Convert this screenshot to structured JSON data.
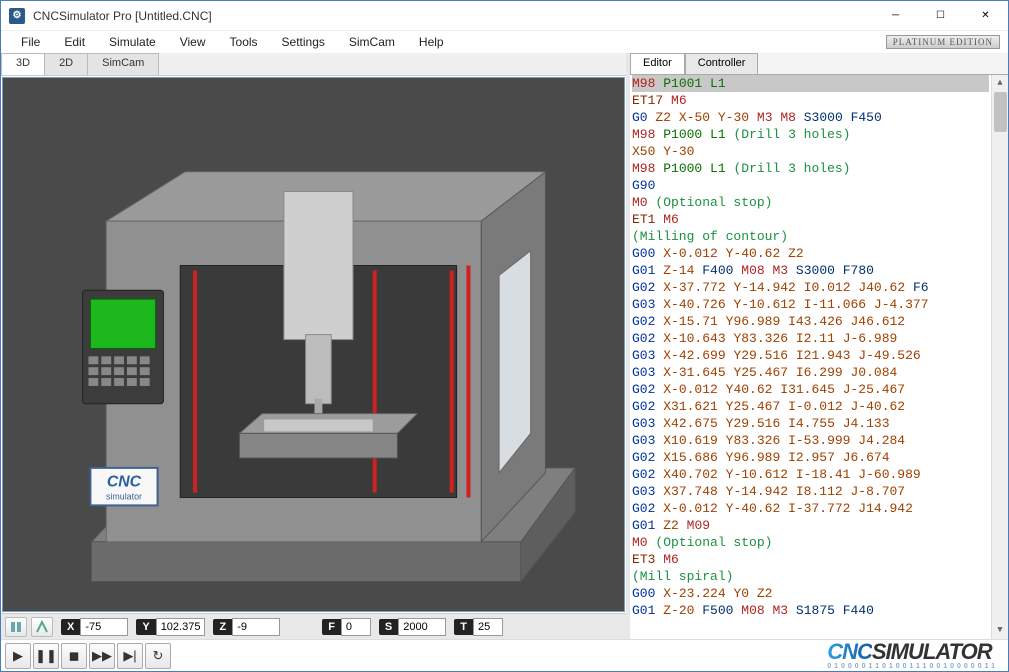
{
  "window": {
    "title": "CNCSimulator Pro [Untitled.CNC]",
    "edition": "PLATINUM EDITION"
  },
  "menu": {
    "items": [
      "File",
      "Edit",
      "Simulate",
      "View",
      "Tools",
      "Settings",
      "SimCam",
      "Help"
    ]
  },
  "view_tabs": {
    "items": [
      "3D",
      "2D",
      "SimCam"
    ],
    "active": "3D"
  },
  "axes": {
    "X": "-75",
    "Y": "102.375",
    "Z": "-9",
    "F": "0",
    "S": "2000",
    "T": "25"
  },
  "editor_tabs": {
    "items": [
      "Editor",
      "Controller"
    ],
    "active": "Editor"
  },
  "code_lines": [
    "M98 P1001 L1",
    "ET17 M6",
    "G0 Z2 X-50 Y-30 M3 M8 S3000 F450",
    "M98 P1000 L1 (Drill 3 holes)",
    "X50 Y-30",
    "M98 P1000 L1 (Drill 3 holes)",
    "G90",
    "M0 (Optional stop)",
    "ET1 M6",
    "(Milling of contour)",
    "G00 X-0.012 Y-40.62 Z2",
    "G01 Z-14 F400 M08 M3 S3000 F780",
    "G02 X-37.772 Y-14.942 I0.012 J40.62 F6",
    "G03 X-40.726 Y-10.612 I-11.066 J-4.377",
    "G02 X-15.71 Y96.989 I43.426 J46.612",
    "G02 X-10.643 Y83.326 I2.11 J-6.989",
    "G03 X-42.699 Y29.516 I21.943 J-49.526",
    "G03 X-31.645 Y25.467 I6.299 J0.084",
    "G02 X-0.012 Y40.62 I31.645 J-25.467",
    "G02 X31.621 Y25.467 I-0.012 J-40.62",
    "G03 X42.675 Y29.516 I4.755 J4.133",
    "G03 X10.619 Y83.326 I-53.999 J4.284",
    "G02 X15.686 Y96.989 I2.957 J6.674",
    "G02 X40.702 Y-10.612 I-18.41 J-60.989",
    "G03 X37.748 Y-14.942 I8.112 J-8.707",
    "G02 X-0.012 Y-40.62 I-37.772 J14.942",
    "G01 Z2 M09",
    "M0 (Optional stop)",
    "ET3 M6",
    "(Mill spiral)",
    "G00 X-23.224 Y0 Z2",
    "G01 Z-20 F500 M08 M3 S1875 F440"
  ],
  "selected_line": 0,
  "brand": {
    "cnc": "CNC",
    "sim": "SIMULATOR",
    "sub": "0100001101001110010000011"
  },
  "machine_logo": {
    "cnc": "CNC",
    "sub": "simulator"
  }
}
